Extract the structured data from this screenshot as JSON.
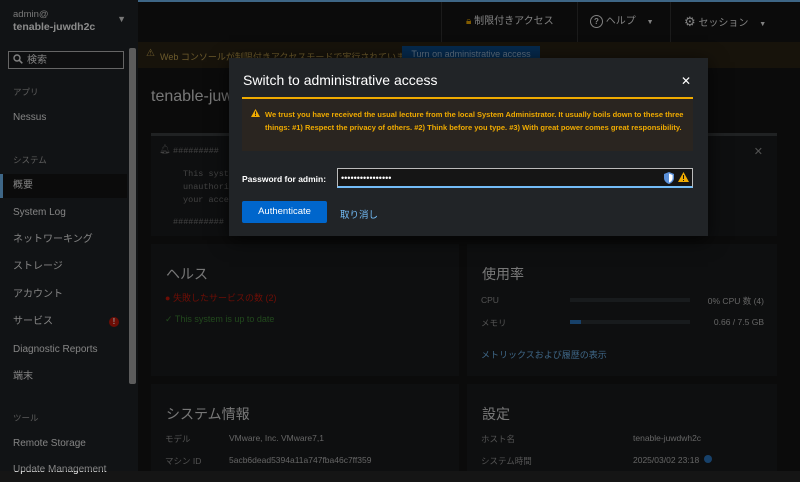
{
  "host_switcher": {
    "user": "admin@",
    "host": "tenable-juwdh2c"
  },
  "search": {
    "placeholder": "検索"
  },
  "sidebar": {
    "section_apps": "アプリ",
    "apps": [
      {
        "label": "Nessus"
      }
    ],
    "section_system": "システム",
    "items": [
      {
        "label": "概要",
        "active": true
      },
      {
        "label": "System Log"
      },
      {
        "label": "ネットワーキング"
      },
      {
        "label": "ストレージ"
      },
      {
        "label": "アカウント"
      },
      {
        "label": "サービス",
        "badge": "!"
      },
      {
        "label": "Diagnostic Reports"
      },
      {
        "label": "端末"
      }
    ],
    "section_tools": "ツール",
    "tools": [
      {
        "label": "Remote Storage"
      },
      {
        "label": "Update Management"
      }
    ]
  },
  "topbar": {
    "limited_access": "制限付きアクセス",
    "help": "ヘルプ",
    "session": "セッション"
  },
  "page": {
    "alert_text": "Web コンソールが制限付きアクセスモードで実行されています。",
    "alert_button": "Turn on administrative access",
    "title": "tenable-juwd",
    "motd_lines": [
      "#########",
      "This syste",
      "unauthori",
      "your accep",
      "##########"
    ],
    "health": {
      "title": "ヘルス",
      "failed_services": "失敗したサービスの数 (2)",
      "up_to_date": "This system is up to date"
    },
    "usage": {
      "title": "使用率",
      "cpu_label": "CPU",
      "cpu_value": "0% CPU 数 (4)",
      "cpu_fraction": 0.0,
      "memory_label": "メモリ",
      "memory_value": "0.66 / 7.5 GB",
      "memory_fraction": 0.088,
      "metrics_link": "メトリックスおよび履歴の表示"
    },
    "system_info": {
      "title": "システム情報",
      "model_label": "モデル",
      "model_value": "VMware, Inc. VMware7,1",
      "machine_id_label": "マシン ID",
      "machine_id_value": "5acb6dead5394a11a747fba46c7ff359"
    },
    "settings": {
      "title": "設定",
      "hostname_label": "ホスト名",
      "hostname_value": "tenable-juwdwh2c",
      "time_label": "システム時間",
      "time_value": "2025/03/02 23:18"
    }
  },
  "modal": {
    "title": "Switch to administrative access",
    "warning": "We trust you have received the usual lecture from the local System Administrator. It usually boils down to these three things: #1) Respect the privacy of others. #2) Think before you type. #3) With great power comes great responsibility.",
    "password_label": "Password for admin:",
    "password_value": "••••••••••••••••",
    "authenticate": "Authenticate",
    "cancel": "取り消し"
  },
  "colors": {
    "accent": "#73bcf7",
    "primary": "#0066cc",
    "warning": "#f0ab00",
    "danger": "#c9190b",
    "success": "#3e8635"
  }
}
